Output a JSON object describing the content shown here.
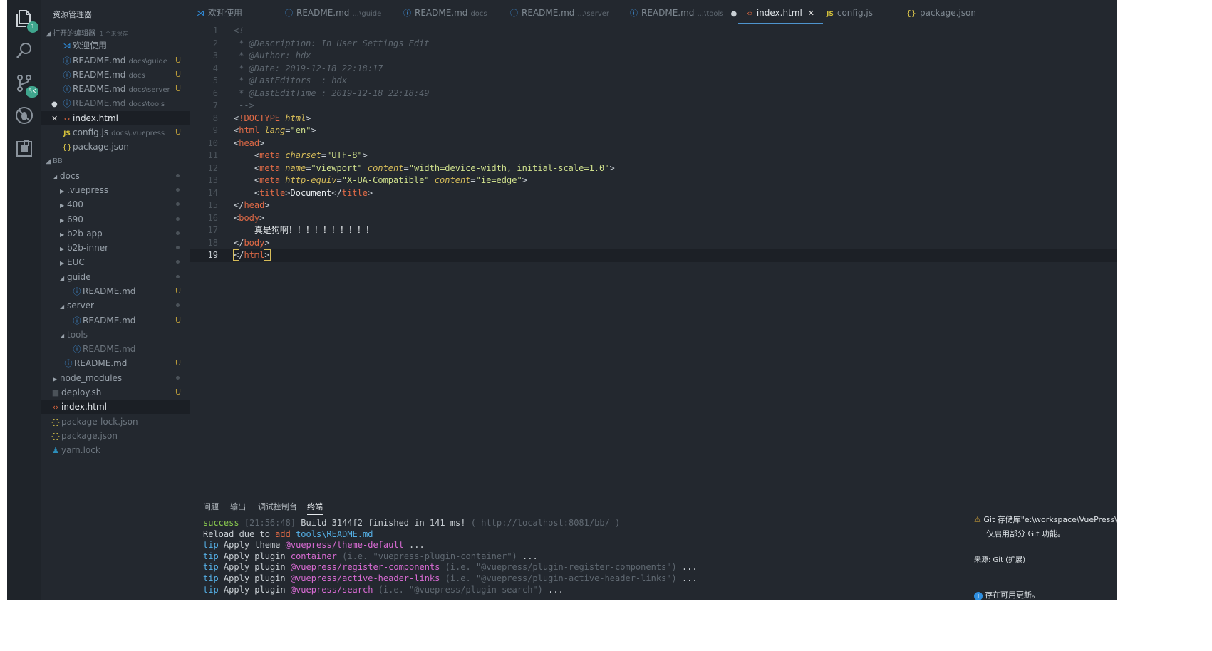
{
  "activity": {
    "explorer_badge": "1",
    "scm_badge": "5K"
  },
  "sidebar": {
    "title": "资源管理器",
    "open_editors": {
      "label": "打开的编辑器",
      "hint": "1 个未保存"
    },
    "open_items": [
      {
        "icon": "vscode-icon",
        "label": "欢迎使用",
        "desc": "",
        "badge": ""
      },
      {
        "icon": "info-icon",
        "label": "README.md",
        "desc": "docs\\guide",
        "badge": "U"
      },
      {
        "icon": "info-icon",
        "label": "README.md",
        "desc": "docs",
        "badge": "U"
      },
      {
        "icon": "info-icon",
        "label": "README.md",
        "desc": "docs\\server",
        "badge": "U"
      },
      {
        "icon": "info-icon",
        "label": "README.md",
        "desc": "docs\\tools",
        "badge": ""
      },
      {
        "icon": "html-icon",
        "label": "index.html",
        "desc": "",
        "badge": ""
      },
      {
        "icon": "js-icon",
        "label": "config.js",
        "desc": "docs\\.vuepress",
        "badge": "U"
      },
      {
        "icon": "json-icon",
        "label": "package.json",
        "desc": "",
        "badge": ""
      }
    ],
    "workspace": {
      "label": "BB"
    },
    "tree": [
      {
        "label": "docs"
      },
      {
        "label": ".vuepress"
      },
      {
        "label": "400"
      },
      {
        "label": "690"
      },
      {
        "label": "b2b-app"
      },
      {
        "label": "b2b-inner"
      },
      {
        "label": "EUC"
      },
      {
        "label": "guide"
      },
      {
        "label": "README.md",
        "badge": "U"
      },
      {
        "label": "server"
      },
      {
        "label": "README.md",
        "badge": "U"
      },
      {
        "label": "tools"
      },
      {
        "label": "README.md"
      },
      {
        "label": "README.md",
        "badge": "U"
      },
      {
        "label": "node_modules"
      },
      {
        "label": "deploy.sh",
        "badge": "U"
      },
      {
        "label": "index.html"
      },
      {
        "label": "package-lock.json"
      },
      {
        "label": "package.json"
      },
      {
        "label": "yarn.lock"
      }
    ]
  },
  "tabs": [
    {
      "icon": "vscode-icon",
      "label": "欢迎使用",
      "desc": ""
    },
    {
      "icon": "info-icon",
      "label": "README.md",
      "desc": "...\\guide"
    },
    {
      "icon": "info-icon",
      "label": "README.md",
      "desc": "docs"
    },
    {
      "icon": "info-icon",
      "label": "README.md",
      "desc": "...\\server"
    },
    {
      "icon": "info-icon",
      "label": "README.md",
      "desc": "...\\tools"
    },
    {
      "icon": "html-icon",
      "label": "index.html",
      "desc": ""
    },
    {
      "icon": "js-icon",
      "label": "config.js",
      "desc": ""
    },
    {
      "icon": "json-icon",
      "label": "package.json",
      "desc": ""
    }
  ],
  "editor": {
    "line_numbers": [
      "1",
      "2",
      "3",
      "4",
      "5",
      "6",
      "7",
      "8",
      "9",
      "10",
      "11",
      "12",
      "13",
      "14",
      "15",
      "16",
      "17",
      "18",
      "19"
    ],
    "comment": {
      "open": "<!--",
      "description": " * @Description: In User Settings Edit",
      "author": " * @Author: hdx",
      "date": " * @Date: 2019-12-18 22:18:17",
      "last_editors": " * @LastEditors  : hdx",
      "last_edit_time": " * @LastEditTime : 2019-12-18 22:18:49",
      "close": " -->"
    },
    "doctype_tag": "!DOCTYPE",
    "doctype_attr": "html",
    "html_tag": "html",
    "lang_attr": "lang",
    "lang_val": "\"en\"",
    "head_tag": "head",
    "meta_tag": "meta",
    "charset_attr": "charset",
    "charset_val": "\"UTF-8\"",
    "name_attr": "name",
    "name_val": "\"viewport\"",
    "content_attr": "content",
    "viewport_content": "\"width=device-width, initial-scale=1.0\"",
    "http_equiv_attr": "http-equiv",
    "http_equiv_val": "\"X-UA-Compatible\"",
    "ie_content": "\"ie=edge\"",
    "title_tag": "title",
    "title_text": "Document",
    "body_tag": "body",
    "body_text": "真是狗啊！！！！！！！！！！"
  },
  "panel": {
    "tabs": [
      "问题",
      "输出",
      "调试控制台",
      "终端"
    ],
    "terminal": {
      "l1_status": "success",
      "l1_time": "[21:56:48]",
      "l1_msg": "Build 3144f2 finished in 141 ms!",
      "l1_url": "( http://localhost:8081/bb/ )",
      "l2_pre": "Reload due to",
      "l2_kw": "add",
      "l2_path": "tools\\README.md",
      "tip": "tip",
      "l3_pre": "Apply theme",
      "l3_name": "@vuepress/theme-default",
      "l3_post": "...",
      "l4_pre": "Apply plugin",
      "l4_name": "container",
      "l4_ie": "(i.e. \"vuepress-plugin-container\")",
      "l4_post": "...",
      "l5_name": "@vuepress/register-components",
      "l5_ie": "(i.e. \"@vuepress/plugin-register-components\")",
      "l6_name": "@vuepress/active-header-links",
      "l6_ie": "(i.e. \"@vuepress/plugin-active-header-links\")",
      "l7_name": "@vuepress/search",
      "l7_ie": "(i.e. \"@vuepress/plugin-search\")"
    }
  },
  "notification": {
    "line1": "Git 存储库\"e:\\workspace\\VuePress\\",
    "line2": "仅启用部分 Git 功能。",
    "source": "来源: Git (扩展)",
    "update": "存在可用更新。"
  }
}
